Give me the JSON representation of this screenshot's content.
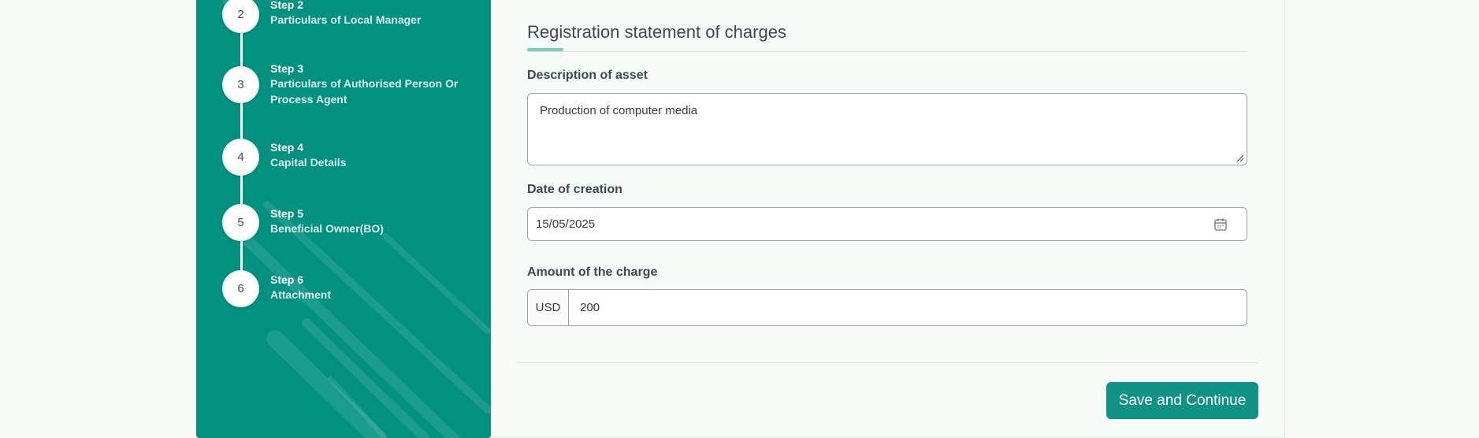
{
  "stepper": {
    "steps": [
      {
        "number": "2",
        "title": "Step 2",
        "subtitle": "Particulars of Local Manager"
      },
      {
        "number": "3",
        "title": "Step 3",
        "subtitle": "Particulars of Authorised Person Or Process Agent"
      },
      {
        "number": "4",
        "title": "Step 4",
        "subtitle": "Capital Details"
      },
      {
        "number": "5",
        "title": "Step 5",
        "subtitle": "Beneficial Owner(BO)"
      },
      {
        "number": "6",
        "title": "Step 6",
        "subtitle": "Attachment"
      }
    ]
  },
  "form": {
    "section_title": "Registration statement of charges",
    "description": {
      "label": "Description of asset",
      "value": "Production of computer media"
    },
    "date": {
      "label": "Date of creation",
      "value": "15/05/2025"
    },
    "amount": {
      "label": "Amount of the charge",
      "currency": "USD",
      "value": "200"
    },
    "save_label": "Save and Continue"
  },
  "colors": {
    "panel": "#03917f",
    "button": "#109384",
    "accent": "#7ccbc0"
  },
  "icons": {
    "date": "calendar-icon",
    "textarea": "resize-grip-icon"
  }
}
